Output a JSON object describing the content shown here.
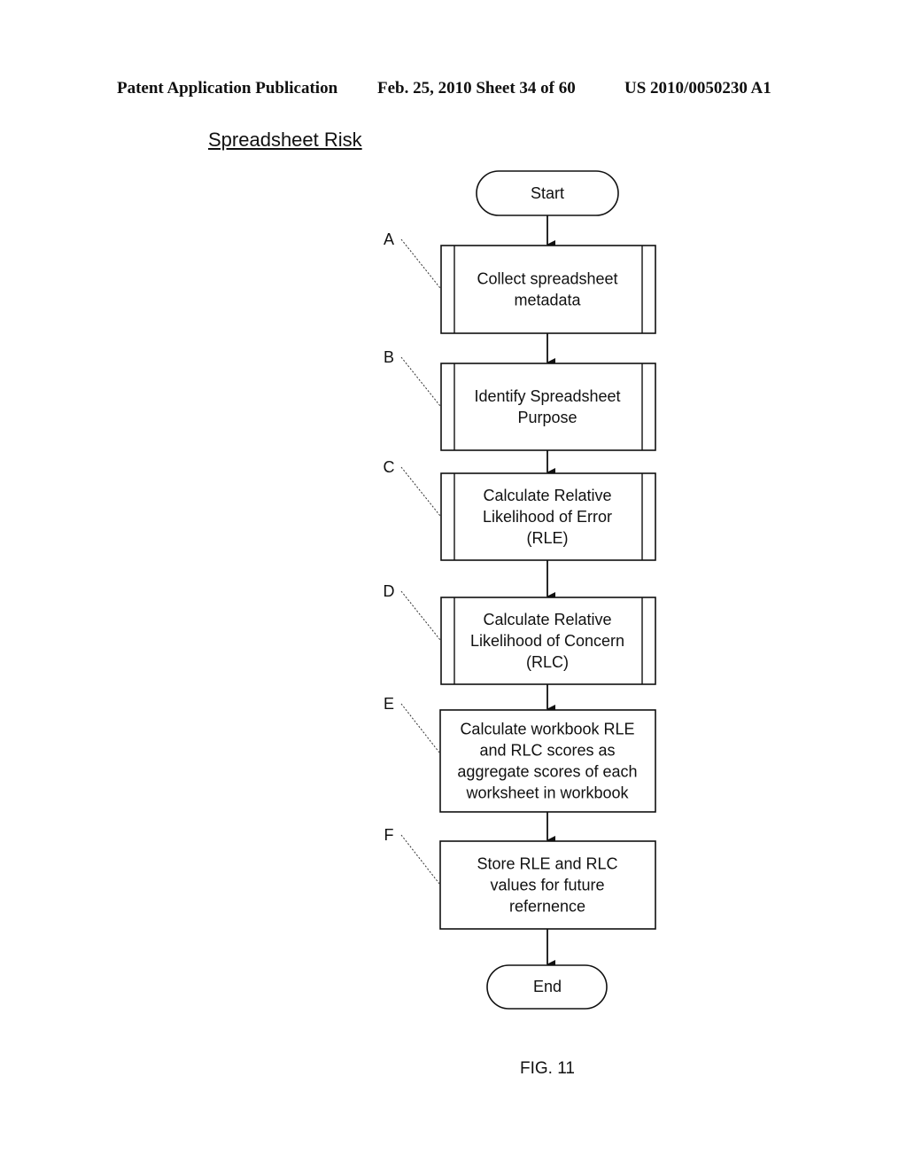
{
  "header": {
    "publication": "Patent Application Publication",
    "date_sheet": "Feb. 25, 2010  Sheet 34 of 60",
    "number": "US 2010/0050230 A1"
  },
  "title": "Spreadsheet Risk",
  "flowchart": {
    "start": "Start",
    "end": "End",
    "steps": [
      {
        "ref": "A",
        "type": "predefined-process",
        "lines": [
          "Collect spreadsheet",
          "metadata"
        ]
      },
      {
        "ref": "B",
        "type": "predefined-process",
        "lines": [
          "Identify Spreadsheet",
          "Purpose"
        ]
      },
      {
        "ref": "C",
        "type": "predefined-process",
        "lines": [
          "Calculate Relative",
          "Likelihood of Error",
          "(RLE)"
        ]
      },
      {
        "ref": "D",
        "type": "predefined-process",
        "lines": [
          "Calculate Relative",
          "Likelihood of Concern",
          "(RLC)"
        ]
      },
      {
        "ref": "E",
        "type": "process",
        "lines": [
          "Calculate workbook RLE",
          "and RLC scores as",
          "aggregate scores of each",
          "worksheet in workbook"
        ]
      },
      {
        "ref": "F",
        "type": "process",
        "lines": [
          "Store RLE and RLC",
          "values for future",
          "refernence"
        ]
      }
    ]
  },
  "figure_label": "FIG. 11"
}
